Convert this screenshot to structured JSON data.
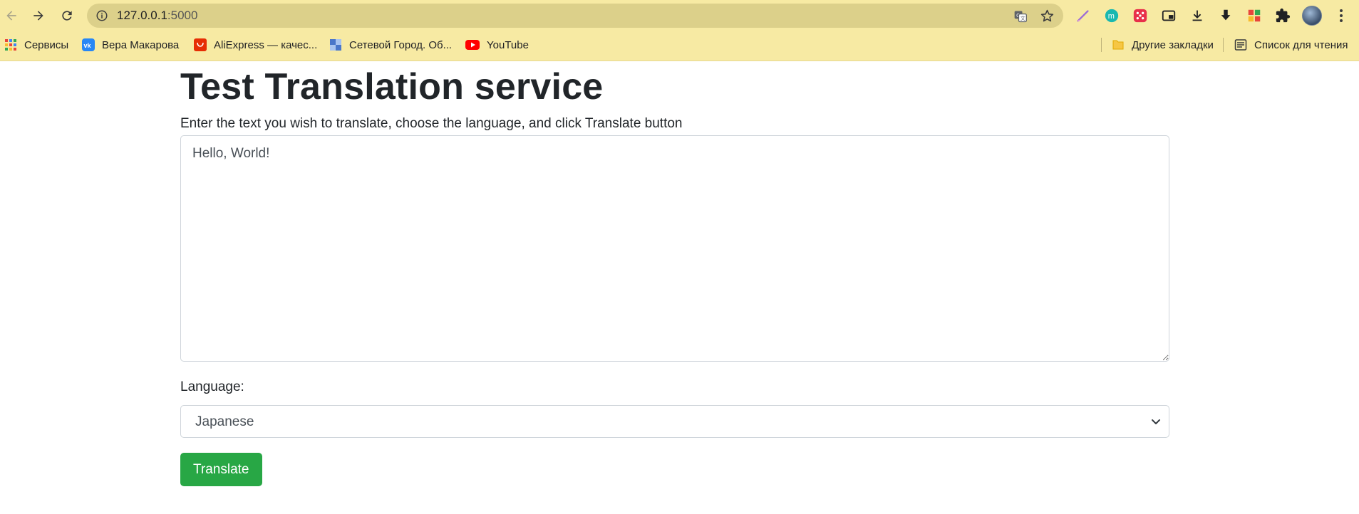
{
  "browser": {
    "url_host": "127.0.0.1",
    "url_port": ":5000",
    "bookmarks": [
      {
        "label": "Сервисы",
        "icon": "apps-grid-icon"
      },
      {
        "label": "Вера Макарова",
        "icon": "vk-icon"
      },
      {
        "label": "AliExpress — качес...",
        "icon": "aliexpress-icon"
      },
      {
        "label": "Сетевой Город. Об...",
        "icon": "site-icon"
      },
      {
        "label": "YouTube",
        "icon": "youtube-icon"
      }
    ],
    "other_bookmarks": "Другие закладки",
    "reading_list": "Список для чтения",
    "colors": {
      "chrome_bg": "#f7eaa3",
      "omnibox_bg": "#dcd08a"
    }
  },
  "page": {
    "title": "Test Translation service",
    "instructions": "Enter the text you wish to translate, choose the language, and click Translate button",
    "text_value": "Hello, World!",
    "language_label": "Language:",
    "language_selected": "Japanese",
    "translate_button": "Translate",
    "colors": {
      "button": "#28a745"
    }
  }
}
